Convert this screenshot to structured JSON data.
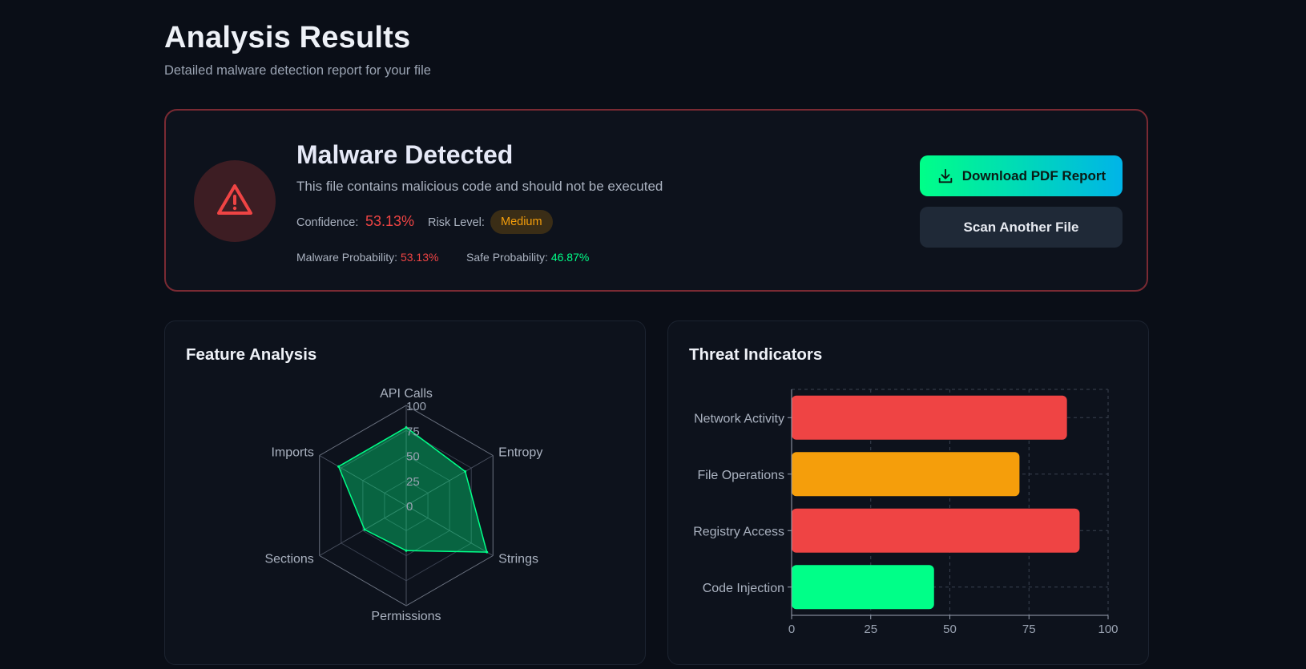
{
  "header": {
    "title": "Analysis Results",
    "subtitle": "Detailed malware detection report for your file"
  },
  "result": {
    "icon": "warning-triangle-icon",
    "title": "Malware Detected",
    "description": "This file contains malicious code and should not be executed",
    "confidence_label": "Confidence:",
    "confidence_value": "53.13%",
    "risk_label": "Risk Level:",
    "risk_value": "Medium",
    "malware_prob_label": "Malware Probability:",
    "malware_prob_value": "53.13%",
    "safe_prob_label": "Safe Probability:",
    "safe_prob_value": "46.87%",
    "colors": {
      "danger": "#ef4444",
      "safe": "#00ff88",
      "warning": "#f59e0b"
    }
  },
  "actions": {
    "download_label": "Download PDF Report",
    "download_icon": "download-icon",
    "scan_label": "Scan Another File"
  },
  "panels": {
    "feature_title": "Feature Analysis",
    "threat_title": "Threat Indicators"
  },
  "chart_data": [
    {
      "type": "radar",
      "axes": [
        "API Calls",
        "Entropy",
        "Strings",
        "Permissions",
        "Sections",
        "Imports"
      ],
      "values": [
        78,
        68,
        93,
        45,
        48,
        78
      ],
      "ticks": [
        "0",
        "25",
        "50",
        "75",
        "100"
      ],
      "range": [
        0,
        100
      ],
      "fill_color": "#00ff88"
    },
    {
      "type": "bar",
      "orientation": "horizontal",
      "categories": [
        "Network Activity",
        "File Operations",
        "Registry Access",
        "Code Injection"
      ],
      "values": [
        87,
        72,
        91,
        45
      ],
      "colors": [
        "#ef4444",
        "#f59e0b",
        "#ef4444",
        "#00ff88"
      ],
      "xticks": [
        "0",
        "25",
        "50",
        "75",
        "100"
      ],
      "xlim": [
        0,
        100
      ],
      "grid": true
    }
  ]
}
